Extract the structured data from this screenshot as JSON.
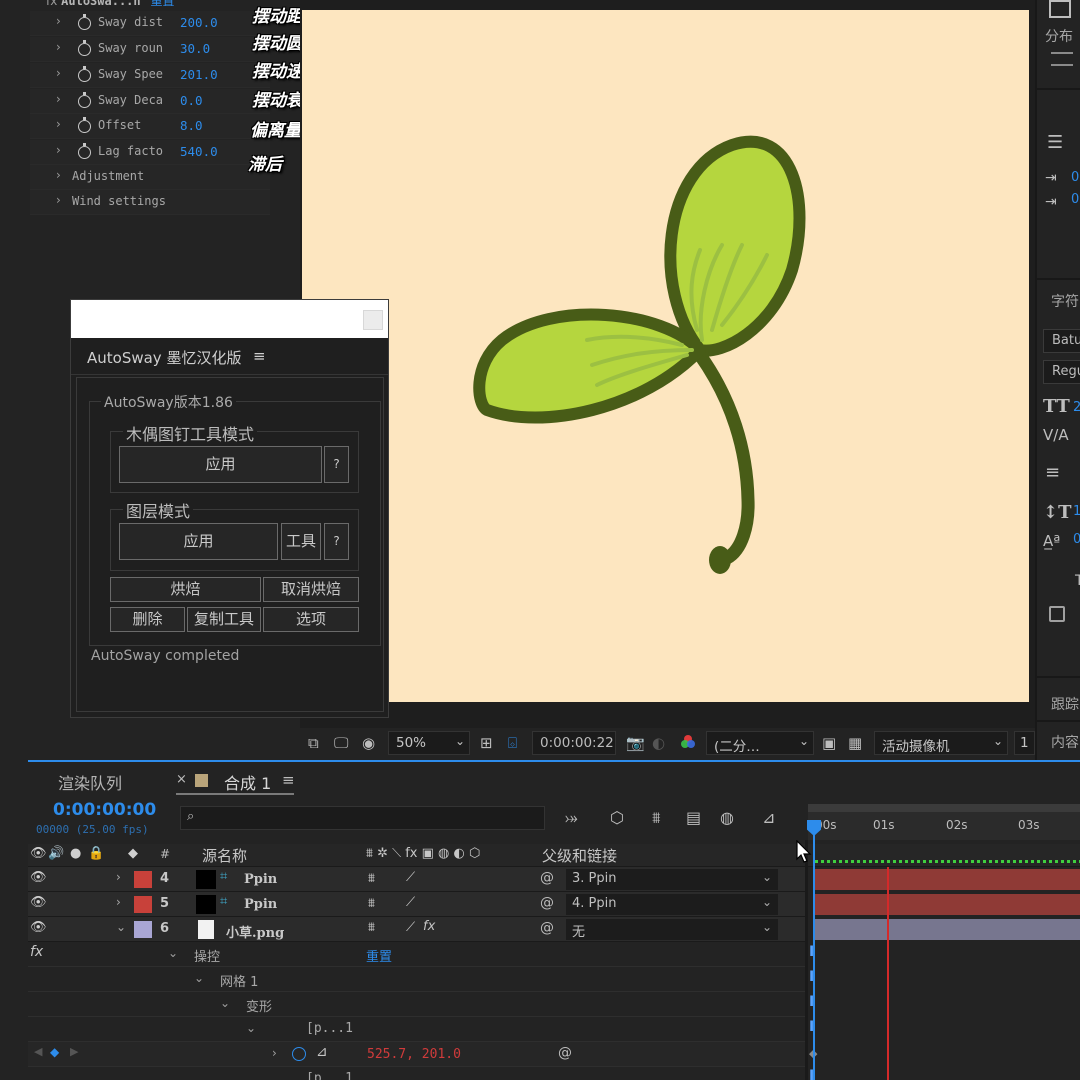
{
  "effect_controls": {
    "effect_name": "AutoSwa...n",
    "reset_label": "重置",
    "properties": [
      {
        "name": "Sway dist",
        "value": "200.0",
        "annotation": "摆动距离"
      },
      {
        "name": "Sway roun",
        "value": "30.0",
        "annotation": "摆动圆度"
      },
      {
        "name": "Sway Spee",
        "value": "201.0",
        "annotation": "摆动速度"
      },
      {
        "name": "Sway Deca",
        "value": "0.0",
        "annotation": "摆动衰退"
      },
      {
        "name": "Offset",
        "value": "8.0",
        "annotation": "偏离量"
      },
      {
        "name": "Lag facto",
        "value": "540.0",
        "annotation": "滞后"
      }
    ],
    "groups": [
      "Adjustment",
      "Wind settings"
    ]
  },
  "autosway": {
    "title": "AutoSway 墨忆汉化版",
    "version": "AutoSway版本1.86",
    "puppet_mode": "木偶图钉工具模式",
    "apply": "应用",
    "help": "?",
    "layer_mode": "图层模式",
    "tools": "工具",
    "bake": "烘焙",
    "unbake": "取消烘焙",
    "delete": "删除",
    "copy_tool": "复制工具",
    "options": "选项",
    "status": "AutoSway completed"
  },
  "right_panel": {
    "distribute": "分布",
    "character": "字符",
    "font_family": "Batu",
    "font_style": "Regu",
    "size_value": "2",
    "leading_value": "1",
    "baseline_value": "0",
    "indent_a": "0",
    "indent_b": "0",
    "tracker": "跟踪",
    "content": "内容",
    "t_label": "T"
  },
  "viewer": {
    "zoom": "50%",
    "timecode": "0:00:00:22",
    "resolution": "(二分…",
    "camera": "活动摄像机",
    "views": "1"
  },
  "timeline": {
    "tab_render": "渲染队列",
    "tab_comp": "合成 1",
    "timecode": "0:00:00:00",
    "frames": "00000 (25.00 fps)",
    "search_placeholder": "",
    "col_hash": "#",
    "col_source": "源名称",
    "col_parent": "父级和链接",
    "ruler": [
      "00s",
      "01s",
      "02s",
      "03s"
    ],
    "layers": [
      {
        "num": "4",
        "name": "Ppin",
        "parent": "3. Ppin",
        "color": "#c8413a"
      },
      {
        "num": "5",
        "name": "Ppin",
        "parent": "4. Ppin",
        "color": "#c8413a"
      },
      {
        "num": "6",
        "name": "小草.png",
        "parent": "无",
        "color": "#a9a6d4"
      }
    ],
    "fx_label": "fx",
    "puppet": "操控",
    "reset": "重置",
    "mesh": "网格 1",
    "deform": "变形",
    "pin_name": "[p...1",
    "pin_value": "525.7, 201.0",
    "pin_name_2": "[p...1"
  },
  "colors": {
    "accent": "#2d8ceb",
    "canvas": "#fde6c0",
    "leaf": "#b5d63e",
    "outline": "#485c17",
    "playhead": "#d42a2a"
  }
}
